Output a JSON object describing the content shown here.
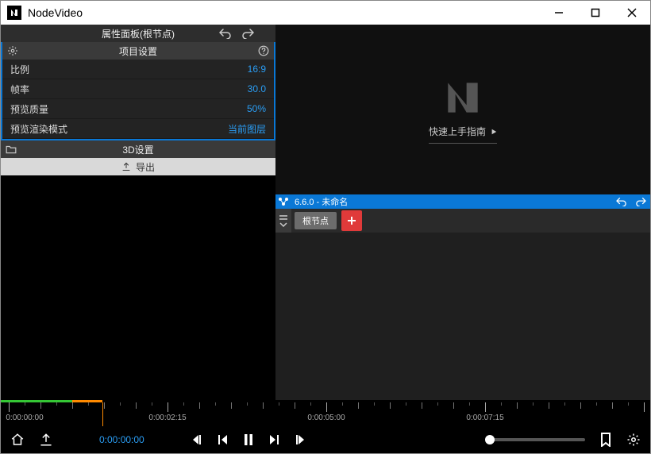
{
  "app": {
    "title": "NodeVideo"
  },
  "panel": {
    "header": "属性面板(根节点)",
    "project_settings": "项目设置",
    "rows": {
      "ratio_label": "比例",
      "ratio_value": "16:9",
      "fps_label": "帧率",
      "fps_value": "30.0",
      "preview_quality_label": "预览质量",
      "preview_quality_value": "50%",
      "render_mode_label": "预览渲染模式",
      "render_mode_value": "当前图层"
    },
    "settings_3d": "3D设置",
    "export_label": "导出"
  },
  "preview": {
    "guide_link": "快速上手指南"
  },
  "timeline_header": {
    "title": "6.6.0 - 未命名"
  },
  "track": {
    "root_node": "根节点"
  },
  "ruler": {
    "labels": [
      "0:00:00:00",
      "0:00:02:15",
      "0:00:05:00",
      "0:00:07:15"
    ]
  },
  "transport": {
    "timecode": "0:00:00:00"
  }
}
